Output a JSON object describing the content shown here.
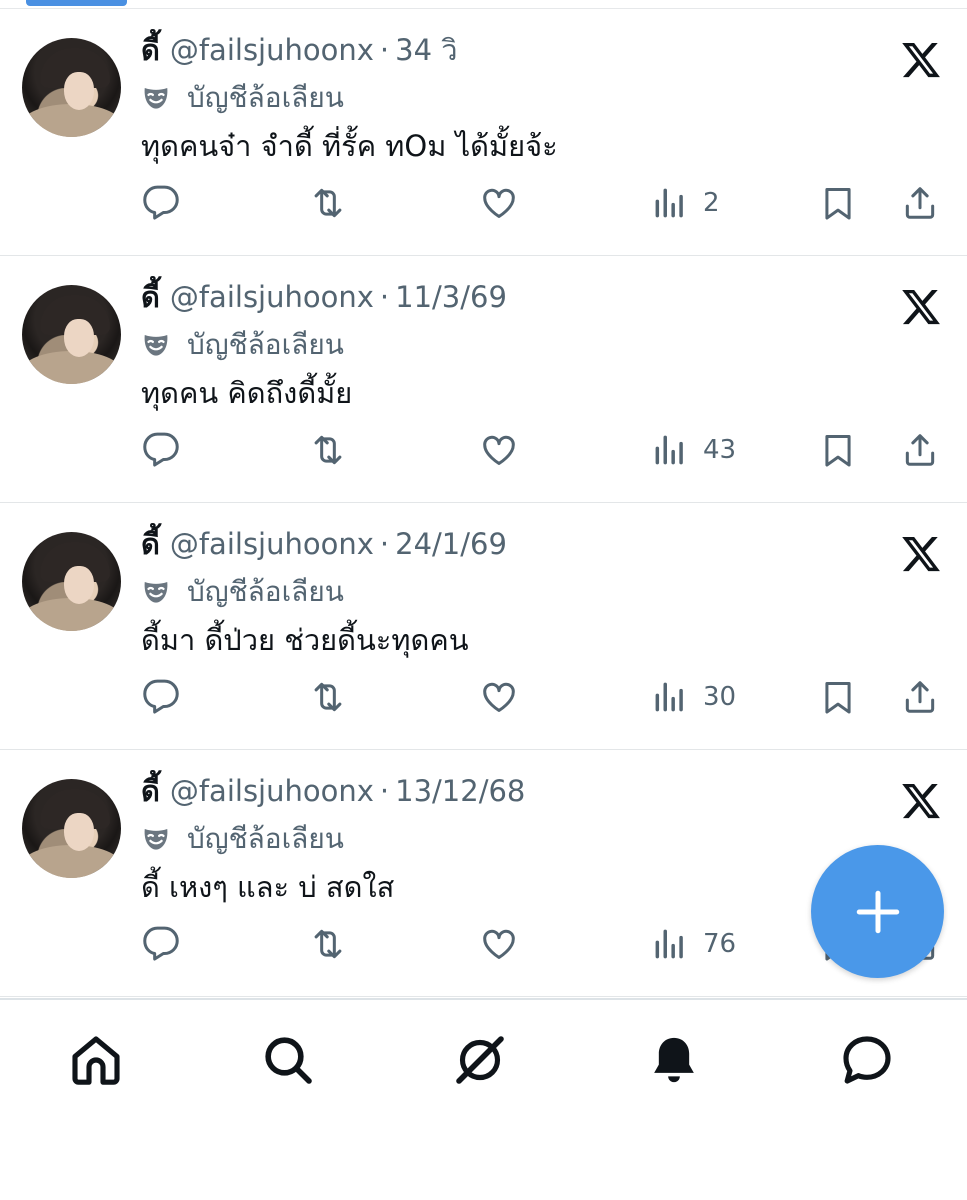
{
  "colors": {
    "accent": "#4a98e9",
    "text_primary": "#0f1419",
    "text_secondary": "#536471"
  },
  "tweets": [
    {
      "name": "ดี้",
      "handle": "@failsjuhoonx",
      "time": "34 วิ",
      "label": "บัญชีล้อเลียน",
      "text": "ทุดคนจ๋า จำดี้ ที่รั้ค ทOม ได้มั้ยจ้ะ",
      "views": "2"
    },
    {
      "name": "ดี้",
      "handle": "@failsjuhoonx",
      "time": "11/3/69",
      "label": "บัญชีล้อเลียน",
      "text": "ทุดคน คิดถึงดี้มั้ย",
      "views": "43"
    },
    {
      "name": "ดี้",
      "handle": "@failsjuhoonx",
      "time": "24/1/69",
      "label": "บัญชีล้อเลียน",
      "text": "ดี้มา ดี้ป่วย ช่วยดี้นะทุดคน",
      "views": "30"
    },
    {
      "name": "ดี้",
      "handle": "@failsjuhoonx",
      "time": "13/12/68",
      "label": "บัญชีล้อเลียน",
      "text": "ดี้ เหงๆ และ บ่ สดใส",
      "views": "76"
    }
  ],
  "icons": {
    "tweet_actions": [
      "reply-icon",
      "retweet-icon",
      "like-icon",
      "views-icon",
      "bookmark-icon",
      "share-icon"
    ],
    "bottom_nav": [
      "home-icon",
      "search-icon",
      "grok-icon",
      "notifications-icon",
      "messages-icon"
    ],
    "fab": "compose-plus-icon"
  }
}
